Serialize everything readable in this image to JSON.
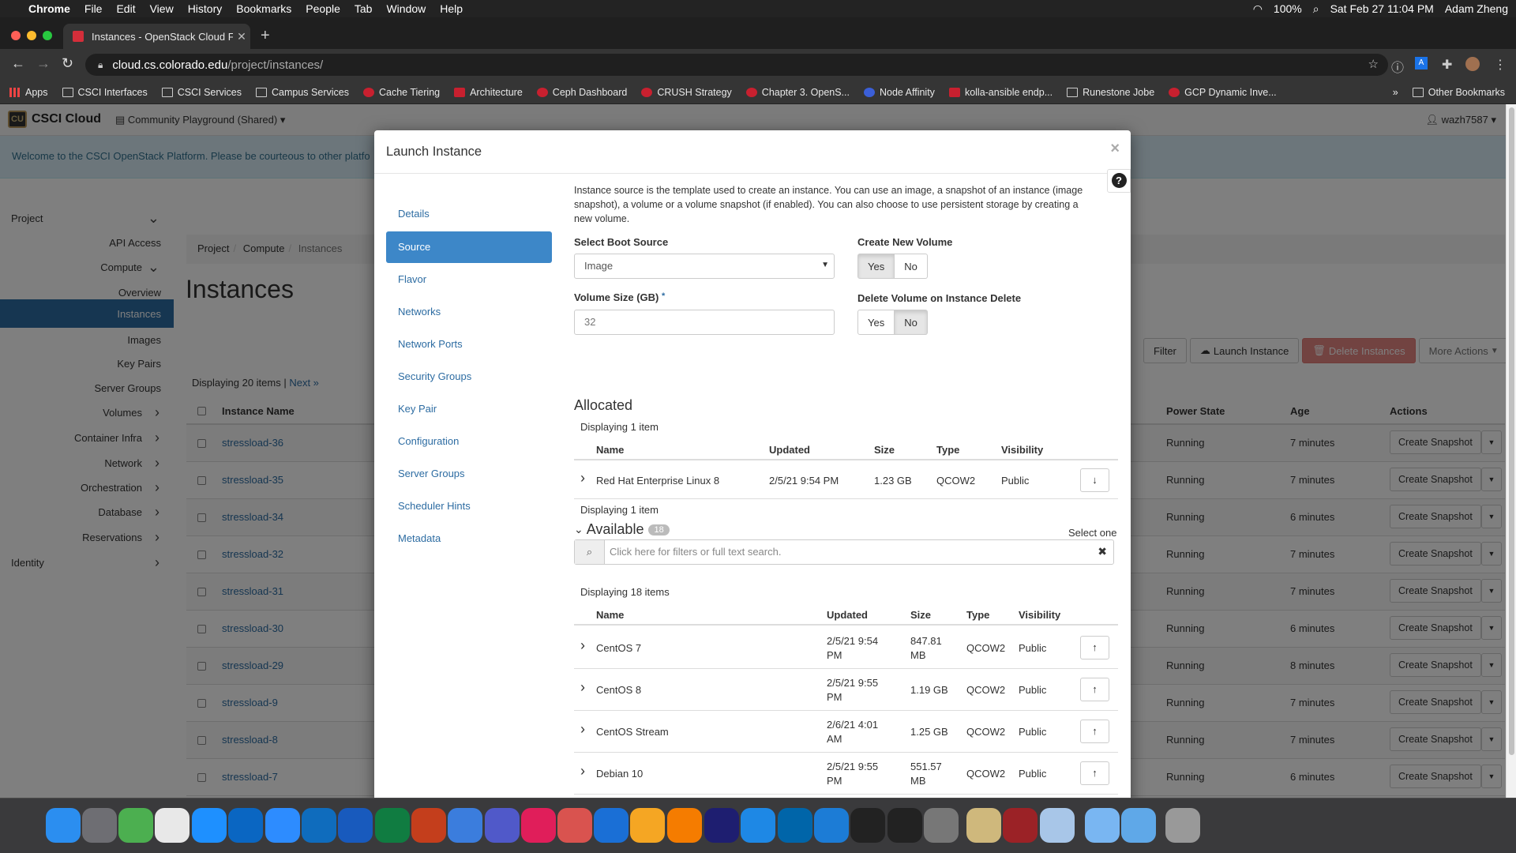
{
  "menubar": {
    "apple": "",
    "items": [
      "Chrome",
      "File",
      "Edit",
      "View",
      "History",
      "Bookmarks",
      "People",
      "Tab",
      "Window",
      "Help"
    ],
    "battery": "100%",
    "datetime": "Sat Feb 27  11:04 PM",
    "user": "Adam Zheng"
  },
  "browser": {
    "tab_title": "Instances - OpenStack Cloud F",
    "url_host": "cloud.cs.colorado.edu",
    "url_path": "/project/instances/",
    "bookmarks": [
      {
        "label": "Apps",
        "icon": "apps-icon"
      },
      {
        "label": "CSCI Interfaces",
        "icon": "folder-icon"
      },
      {
        "label": "CSCI Services",
        "icon": "folder-icon"
      },
      {
        "label": "Campus Services",
        "icon": "folder-icon"
      },
      {
        "label": "Cache Tiering",
        "icon": "redhat-icon"
      },
      {
        "label": "Architecture",
        "icon": "openstack-icon"
      },
      {
        "label": "Ceph Dashboard",
        "icon": "ceph-icon"
      },
      {
        "label": "CRUSH Strategy",
        "icon": "redhat-icon"
      },
      {
        "label": "Chapter 3. OpenS...",
        "icon": "redhat-icon"
      },
      {
        "label": "Node Affinity",
        "icon": "k8s-icon"
      },
      {
        "label": "kolla-ansible endp...",
        "icon": "openstack-icon"
      },
      {
        "label": "Runestone Jobe",
        "icon": "page-icon"
      },
      {
        "label": "GCP Dynamic Inve...",
        "icon": "ansible-icon"
      }
    ],
    "other_bookmarks": "Other Bookmarks"
  },
  "app": {
    "brand": "CSCI Cloud",
    "project_selector": "Community Playground (Shared)",
    "user": "wazh7587",
    "welcome": "Welcome to the CSCI OpenStack Platform. Please be courteous to other platfo",
    "sidebar": [
      {
        "label": "Project",
        "level": 1,
        "chev": "v"
      },
      {
        "label": "API Access",
        "level": 3
      },
      {
        "label": "Compute",
        "level": 2,
        "chev": "v"
      },
      {
        "label": "Overview",
        "level": 3
      },
      {
        "label": "Instances",
        "level": 3,
        "active": true
      },
      {
        "label": "Images",
        "level": 3
      },
      {
        "label": "Key Pairs",
        "level": 3
      },
      {
        "label": "Server Groups",
        "level": 3
      },
      {
        "label": "Volumes",
        "level": 2,
        "chev": ">"
      },
      {
        "label": "Container Infra",
        "level": 2,
        "chev": ">"
      },
      {
        "label": "Network",
        "level": 2,
        "chev": ">"
      },
      {
        "label": "Orchestration",
        "level": 2,
        "chev": ">"
      },
      {
        "label": "Database",
        "level": 2,
        "chev": ">"
      },
      {
        "label": "Reservations",
        "level": 2,
        "chev": ">"
      },
      {
        "label": "Identity",
        "level": 1,
        "chev": ">"
      }
    ],
    "breadcrumb": [
      "Project",
      "Compute",
      "Instances"
    ],
    "page_title": "Instances",
    "buttons": {
      "filter": "Filter",
      "launch": "Launch Instance",
      "delete": "Delete Instances",
      "more": "More Actions"
    },
    "displaying": "Displaying 20 items | ",
    "next": "Next »",
    "columns": {
      "name": "Instance Name",
      "power": "Power State",
      "age": "Age",
      "actions": "Actions"
    },
    "rows": [
      {
        "name": "stressload-36",
        "power": "Running",
        "age": "7 minutes",
        "action": "Create Snapshot"
      },
      {
        "name": "stressload-35",
        "power": "Running",
        "age": "7 minutes",
        "action": "Create Snapshot"
      },
      {
        "name": "stressload-34",
        "power": "Running",
        "age": "6 minutes",
        "action": "Create Snapshot"
      },
      {
        "name": "stressload-32",
        "power": "Running",
        "age": "7 minutes",
        "action": "Create Snapshot"
      },
      {
        "name": "stressload-31",
        "power": "Running",
        "age": "7 minutes",
        "action": "Create Snapshot"
      },
      {
        "name": "stressload-30",
        "power": "Running",
        "age": "6 minutes",
        "action": "Create Snapshot"
      },
      {
        "name": "stressload-29",
        "power": "Running",
        "age": "8 minutes",
        "action": "Create Snapshot"
      },
      {
        "name": "stressload-9",
        "power": "Running",
        "age": "7 minutes",
        "action": "Create Snapshot"
      },
      {
        "name": "stressload-8",
        "power": "Running",
        "age": "7 minutes",
        "action": "Create Snapshot"
      },
      {
        "name": "stressload-7",
        "power": "Running",
        "age": "6 minutes",
        "action": "Create Snapshot"
      }
    ]
  },
  "modal": {
    "title": "Launch Instance",
    "steps": [
      "Details",
      "Source",
      "Flavor",
      "Networks",
      "Network Ports",
      "Security Groups",
      "Key Pair",
      "Configuration",
      "Server Groups",
      "Scheduler Hints",
      "Metadata"
    ],
    "active_step": "Source",
    "intro": "Instance source is the template used to create an instance. You can use an image, a snapshot of an instance (image snapshot), a volume or a volume snapshot (if enabled). You can also choose to use persistent storage by creating a new volume.",
    "boot_source_label": "Select Boot Source",
    "boot_source_value": "Image",
    "create_volume_label": "Create New Volume",
    "yes": "Yes",
    "no": "No",
    "create_volume": "Yes",
    "volume_size_label": "Volume Size (GB)",
    "volume_size_required": "*",
    "volume_size_value": "32",
    "delete_volume_label": "Delete Volume on Instance Delete",
    "delete_volume": "No",
    "allocated_title": "Allocated",
    "allocated_count": "Displaying 1 item",
    "allocated_columns": [
      "Name",
      "Updated",
      "Size",
      "Type",
      "Visibility"
    ],
    "allocated": [
      {
        "name": "Red Hat Enterprise Linux 8",
        "updated": "2/5/21 9:54 PM",
        "size": "1.23 GB",
        "type": "QCOW2",
        "visibility": "Public"
      }
    ],
    "available_title": "Available",
    "available_badge": "18",
    "select_one": "Select one",
    "search_placeholder": "Click here for filters or full text search.",
    "available_count": "Displaying 18 items",
    "available_columns": [
      "Name",
      "Updated",
      "Size",
      "Type",
      "Visibility"
    ],
    "available": [
      {
        "name": "CentOS 7",
        "updated1": "2/5/21 9:54",
        "updated2": "PM",
        "size1": "847.81",
        "size2": "MB",
        "type": "QCOW2",
        "visibility": "Public"
      },
      {
        "name": "CentOS 8",
        "updated1": "2/5/21 9:55",
        "updated2": "PM",
        "size1": "1.19 GB",
        "size2": "",
        "type": "QCOW2",
        "visibility": "Public"
      },
      {
        "name": "CentOS Stream",
        "updated1": "2/6/21 4:01",
        "updated2": "AM",
        "size1": "1.25 GB",
        "size2": "",
        "type": "QCOW2",
        "visibility": "Public"
      },
      {
        "name": "Debian 10",
        "updated1": "2/5/21 9:55",
        "updated2": "PM",
        "size1": "551.57",
        "size2": "MB",
        "type": "QCOW2",
        "visibility": "Public"
      }
    ]
  },
  "dock": [
    "Finder",
    "Launchpad",
    "Maps",
    "Chrome",
    "Safari",
    "1Password",
    "Zoom",
    "Outlook",
    "Word",
    "Excel",
    "PowerPoint",
    "Keynote",
    "Teams",
    "Slack",
    "Remote Desktop",
    "Parallels",
    "Sketch",
    "Spotify",
    "Premiere",
    "MacDown",
    "VS Code",
    "Xcode",
    "Activity Monitor",
    "Terminal",
    "System Preferences",
    "CU",
    "Dictionary",
    "Preview",
    "Folder",
    "Downloads",
    "Trash"
  ]
}
